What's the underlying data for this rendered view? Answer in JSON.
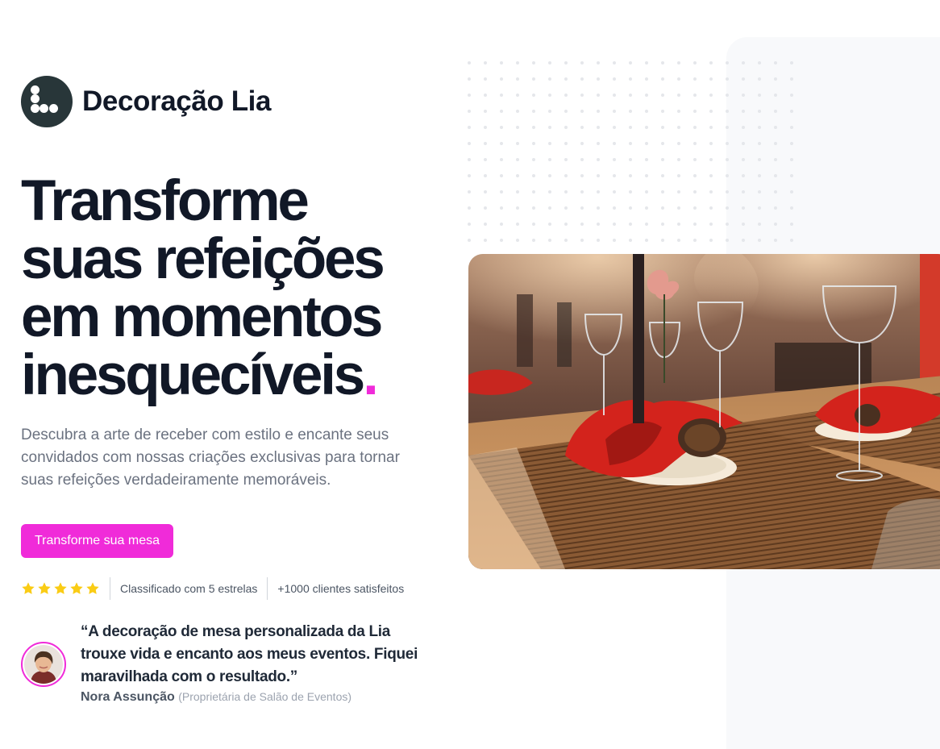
{
  "brand": {
    "name": "Decoração Lia",
    "logo_icon": "dots-logo-icon"
  },
  "hero": {
    "headline_lines": [
      "Transforme",
      "suas refeições",
      "em momentos",
      "inesquecíveis"
    ],
    "headline_accent": ".",
    "description": "Descubra a arte de receber com estilo e encante seus convidados com nossas criações exclusivas para tornar suas refeições verdadeiramente memoráveis.",
    "cta_label": "Transforme sua mesa"
  },
  "rating": {
    "stars": 5,
    "stars_max": 5,
    "rating_text": "Classificado com 5 estrelas",
    "customers_text": "+1000 clientes satisfeitos",
    "star_color": "#facc15"
  },
  "testimonial": {
    "quote": "“A decoração de mesa personalizada da Lia trouxe vida e encanto aos meus eventos. Fiquei maravilhada com o resultado.”",
    "author_name": "Nora Assunção",
    "author_role": "(Proprietária de Salão de Eventos)"
  },
  "colors": {
    "accent": "#f02bd9",
    "text_dark": "#111827",
    "text_muted": "#6b7280",
    "logo_bg": "#283639",
    "panel_bg": "#f8f9fb"
  }
}
